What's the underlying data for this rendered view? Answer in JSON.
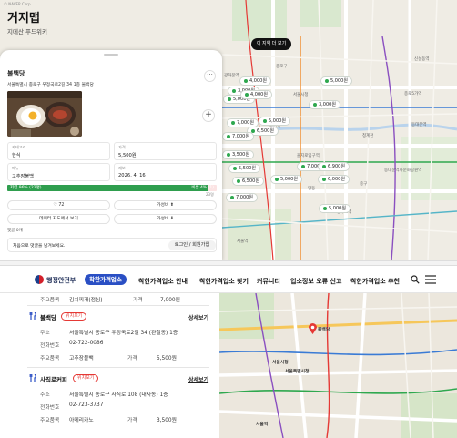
{
  "top": {
    "watermark": "© NAVER Corp.",
    "brand_title": "거지맵",
    "brand_subtitle": "지메산 푸드위키",
    "search_area_button": "이 지역 더 보기",
    "price_pins": [
      "4,000원",
      "3,000원",
      "5,000원",
      "5,000원",
      "4,000원",
      "3,000원",
      "7,000원",
      "5,000원",
      "6,500원",
      "7,000원",
      "3,500원",
      "7,000원",
      "5,500원",
      "6,500원",
      "6,900원",
      "7,000원",
      "5,000원",
      "6,000원",
      "5,000원"
    ],
    "map_labels": [
      "종로구",
      "서울시청",
      "종로5가역",
      "신설동역",
      "중구",
      "동대문역사문화공원역",
      "청계천",
      "명동",
      "충무로역",
      "광화문역",
      "종각역",
      "을지로입구역",
      "동대문역",
      "서울역"
    ],
    "panel": {
      "place_name": "불백당",
      "address": "서울특별시 종로구 우정국로2길 34 1층 불백당",
      "more_label": "···",
      "plus_label": "+",
      "info": [
        {
          "key": "카테고리",
          "value": "한식"
        },
        {
          "key": "가격",
          "value": "5,500원"
        },
        {
          "key": "메뉴",
          "value": "고추장불백"
        },
        {
          "key": "제보",
          "value": "2026. 4. 16"
        }
      ],
      "progress": {
        "left": "저렴 96% (22명)",
        "right": "비쌈 4% (1)",
        "ratio": 0.96,
        "count": "23명"
      },
      "buttons": {
        "likes": "♡ 72",
        "cheap": "가성비 ⬆",
        "map": "데이터 지도에서 보기",
        "not_cheap": "가성비 ⬇"
      },
      "comment_label": "댓글 0개",
      "comment_hint": "처음으로 댓글을 남겨보세요.",
      "login_button": "로그인 / 회원가입"
    }
  },
  "bottom": {
    "gov_name": "행정안전부",
    "site_badge": "착한가격업소",
    "nav": [
      "착한가격업소 안내",
      "착한가격업소 찾기",
      "커뮤니티",
      "업소정보 오류 신고",
      "착한가격업소 추천"
    ],
    "prev_item": {
      "menu_key": "주요품목",
      "menu": "김치찌개(점심)",
      "price_key": "가격",
      "price": "7,000원"
    },
    "stores": [
      {
        "name": "불백당",
        "loc_button": "위치보기",
        "detail": "상세보기",
        "addr_key": "주소",
        "addr": "서울특별시 종로구 우정국로2길 34 (관철동) 1층",
        "phone_key": "전화번호",
        "phone": "02-722-0086",
        "menu_key": "주요품목",
        "menu": "고추장불백",
        "price_key": "가격",
        "price": "5,500원"
      },
      {
        "name": "사직로커피",
        "loc_button": "위치보기",
        "detail": "상세보기",
        "addr_key": "주소",
        "addr": "서울특별시 종로구 사직로 108 (내자동) 1층",
        "phone_key": "전화번호",
        "phone": "02-723-3737",
        "menu_key": "주요품목",
        "menu": "아메리카노",
        "price_key": "가격",
        "price": "3,500원"
      }
    ],
    "map_labels": [
      "불백당",
      "서울시청",
      "서울특별시청",
      "서울역"
    ],
    "colors": {
      "accent": "#2a4fc4",
      "red": "#e53935",
      "green": "#2f9e4e"
    }
  }
}
